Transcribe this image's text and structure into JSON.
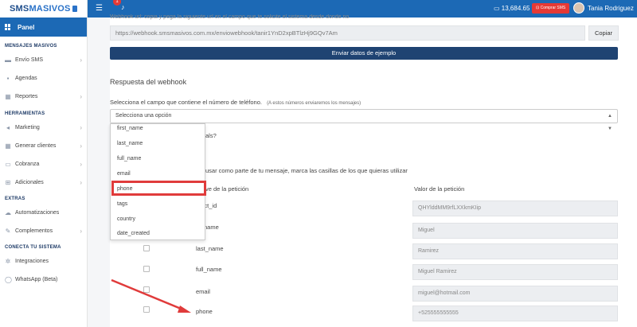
{
  "brand": {
    "logo_text_a": "SMS",
    "logo_text_b": "MASIVOS"
  },
  "sidebar": {
    "panel_label": "Panel",
    "sections": [
      {
        "title": "MENSAJES MASIVOS",
        "items": [
          {
            "label": "Envío SMS",
            "icon": "chat-icon",
            "chevron": true
          },
          {
            "label": "Agendas",
            "icon": "book-icon",
            "chevron": false
          },
          {
            "label": "Reportes",
            "icon": "chart-icon",
            "chevron": true
          }
        ]
      },
      {
        "title": "HERRAMIENTAS",
        "items": [
          {
            "label": "Marketing",
            "icon": "megaphone-icon",
            "chevron": true
          },
          {
            "label": "Generar clientes",
            "icon": "grid-icon",
            "chevron": true
          },
          {
            "label": "Cobranza",
            "icon": "card-icon",
            "chevron": true
          },
          {
            "label": "Adicionales",
            "icon": "plus-icon",
            "chevron": true
          }
        ]
      },
      {
        "title": "EXTRAS",
        "items": [
          {
            "label": "Automatizaciones",
            "icon": "cloud-icon",
            "chevron": false
          },
          {
            "label": "Complementos",
            "icon": "wrench-icon",
            "chevron": true
          }
        ]
      },
      {
        "title": "CONECTA TU SISTEMA",
        "items": [
          {
            "label": "Integraciones",
            "icon": "gear-icon",
            "chevron": false
          },
          {
            "label": "WhatsApp (Beta)",
            "icon": "whatsapp-icon",
            "chevron": false
          }
        ]
      }
    ]
  },
  "topbar": {
    "notifications_count": "1",
    "balance": "13,684.65",
    "buy_label": "Comprar SMS",
    "user_name": "Tania Rodriguez"
  },
  "webhook": {
    "hint": "Webhook url: copia y pega la siguiente url en el campo que te solicite el sistema desde donde nos enviarás datos.",
    "url": "https://webhook.smsmasivos.com.mx/enviowebhook/tanir1YnD2xpBTlzHj9GQv7Am",
    "copy_label": "Copiar",
    "send_label": "Enviar datos de ejemplo"
  },
  "response": {
    "title": "Respuesta del webhook",
    "phone_field_label": "Selecciona el campo que contiene el número de teléfono.",
    "phone_field_note": "(A estos números enviaremos los mensajes)",
    "select_placeholder": "Selecciona una opción",
    "options": [
      "first_name",
      "last_name",
      "full_name",
      "email",
      "phone",
      "tags",
      "country",
      "date_created"
    ],
    "highlighted_option": "phone",
    "question_fragment": "als?",
    "info_fragment": "usar como parte de tu mensaje, marca las casillas de los que quieras utilizar",
    "col_key_header": "ve de la petición",
    "col_value_header": "Valor de la petición"
  },
  "variables": [
    {
      "key": "ntact_id",
      "value": "QHYlddMM9rfLXXkmKIip"
    },
    {
      "key": "st_name",
      "value": "Miguel"
    },
    {
      "key": "last_name",
      "value": "Ramirez"
    },
    {
      "key": "full_name",
      "value": "Miguel Ramirez"
    },
    {
      "key": "email",
      "value": "miguel@hotmail.com"
    },
    {
      "key": "phone",
      "value": "+525555555555"
    }
  ],
  "colors": {
    "primary": "#1c69b5",
    "dark_button": "#1f4372",
    "danger": "#e53935",
    "highlight": "#e03b3b"
  }
}
